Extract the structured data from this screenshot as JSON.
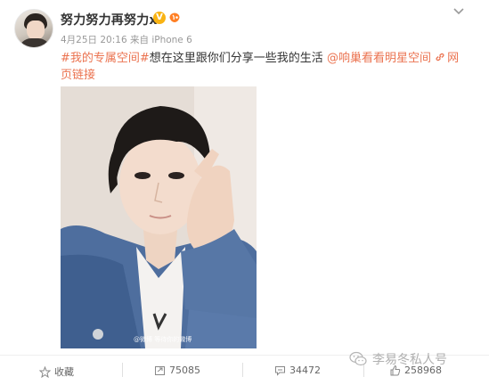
{
  "post": {
    "username": "努力努力再努力x",
    "vip_badge": "V",
    "time": "4月25日 20:16",
    "source_prefix": "来自",
    "source": "iPhone 6",
    "text": {
      "topic": "#我的专属空间#",
      "body": "想在这里跟你们分享一些我的生活",
      "mention": "@响巢看看明星空间",
      "link_label_1": "网",
      "link_label_2": "页链接"
    },
    "photo_watermark": "@微博 等待你的微博"
  },
  "actions": {
    "favorite_label": "收藏",
    "repost_count": "75085",
    "comment_count": "34472",
    "like_count": "258968"
  },
  "overlay": {
    "wechat_watermark": "李易冬私人号"
  },
  "colors": {
    "link": "#eb7350",
    "vip": "#f9b313",
    "muted": "#999999"
  },
  "icons": [
    "avatar",
    "vip-badge-icon",
    "level-badge-icon",
    "menu-arrow-icon",
    "link-icon",
    "star-icon",
    "repost-icon",
    "comment-icon",
    "like-icon",
    "wechat-icon"
  ]
}
